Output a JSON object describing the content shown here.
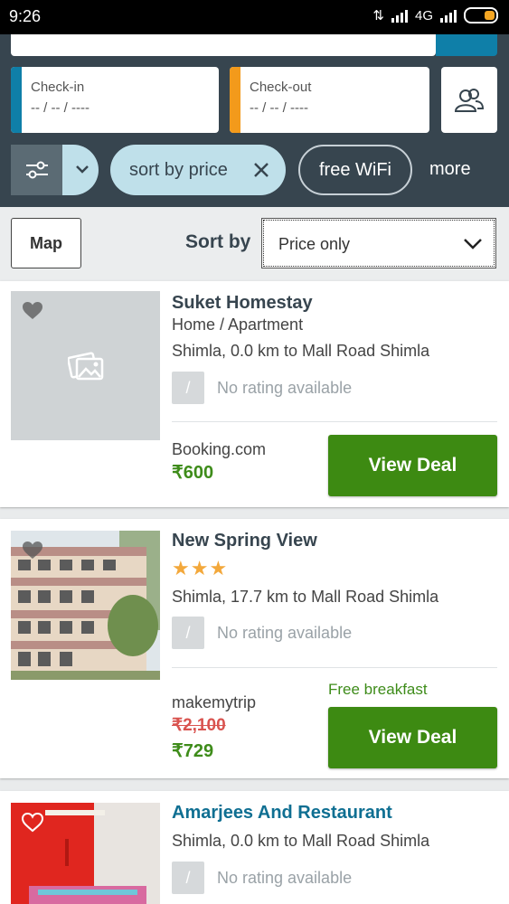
{
  "status_bar": {
    "time": "9:26",
    "network": "4G"
  },
  "search": {
    "checkin_label": "Check-in",
    "checkin_value": "-- / -- / ----",
    "checkout_label": "Check-out",
    "checkout_value": "-- / -- / ----"
  },
  "filters": {
    "sort_chip": "sort by price",
    "wifi_chip": "free WiFi",
    "more": "more"
  },
  "sort_row": {
    "map_label": "Map",
    "sort_label": "Sort by",
    "sort_value": "Price only"
  },
  "hotels": [
    {
      "name": "Suket Homestay",
      "type": "Home / Apartment",
      "location": "Shimla, 0.0 km to Mall Road Shimla",
      "rating_symbol": "/",
      "rating_text": "No rating available",
      "provider": "Booking.com",
      "price": "₹600",
      "deal_label": "View Deal"
    },
    {
      "name": "New Spring View",
      "stars": "★★★",
      "location": "Shimla, 17.7 km to Mall Road Shimla",
      "rating_symbol": "/",
      "rating_text": "No rating available",
      "perk": "Free breakfast",
      "provider": "makemytrip",
      "old_price": "₹2,100",
      "price": "₹729",
      "deal_label": "View Deal"
    },
    {
      "name": "Amarjees And Restaurant",
      "location": "Shimla, 0.0 km to Mall Road Shimla",
      "rating_symbol": "/",
      "rating_text": "No rating available"
    }
  ],
  "colors": {
    "header": "#37454f",
    "checkin_accent": "#0f7fa8",
    "checkout_accent": "#f39a1b",
    "deal_button": "#3d8a12",
    "price": "#3e8c1a",
    "old_price": "#d9534f"
  }
}
